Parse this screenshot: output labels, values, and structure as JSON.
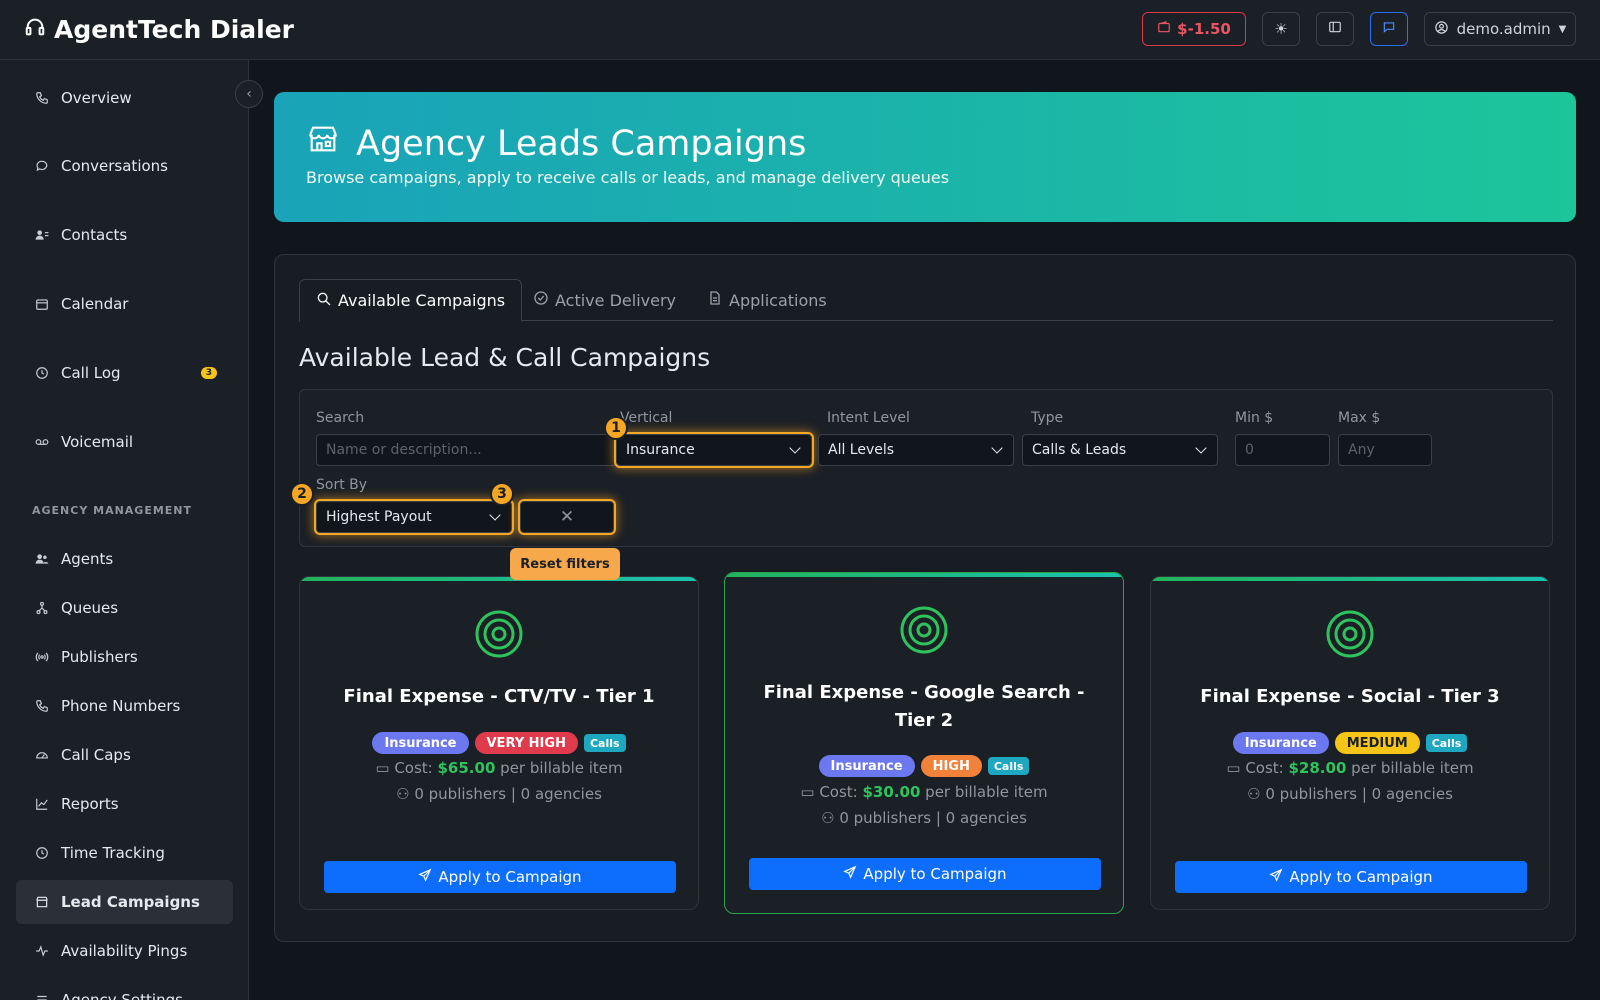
{
  "app": {
    "title": "AgentTech Dialer",
    "balance": "$-1.50",
    "user": "demo.admin"
  },
  "sidebar": {
    "items": [
      {
        "label": "Overview"
      },
      {
        "label": "Conversations"
      },
      {
        "label": "Contacts"
      },
      {
        "label": "Calendar"
      },
      {
        "label": "Call Log",
        "badge": "3"
      },
      {
        "label": "Voicemail"
      }
    ],
    "section_label": "AGENCY MANAGEMENT",
    "agency_items": [
      {
        "label": "Agents"
      },
      {
        "label": "Queues"
      },
      {
        "label": "Publishers"
      },
      {
        "label": "Phone Numbers"
      },
      {
        "label": "Call Caps"
      },
      {
        "label": "Reports"
      },
      {
        "label": "Time Tracking"
      },
      {
        "label": "Lead Campaigns",
        "active": true
      },
      {
        "label": "Availability Pings"
      },
      {
        "label": "Agency Settings"
      }
    ]
  },
  "hero": {
    "title": "Agency Leads Campaigns",
    "subtitle": "Browse campaigns, apply to receive calls or leads, and manage delivery queues"
  },
  "tabs": [
    {
      "label": "Available Campaigns",
      "active": true
    },
    {
      "label": "Active Delivery"
    },
    {
      "label": "Applications"
    }
  ],
  "section_title": "Available Lead & Call Campaigns",
  "filters": {
    "search": {
      "label": "Search",
      "placeholder": "Name or description..."
    },
    "vertical": {
      "label": "Vertical",
      "value": "Insurance"
    },
    "intent": {
      "label": "Intent Level",
      "value": "All Levels"
    },
    "type": {
      "label": "Type",
      "value": "Calls & Leads"
    },
    "min": {
      "label": "Min $",
      "placeholder": "0"
    },
    "max": {
      "label": "Max $",
      "placeholder": "Any"
    },
    "sort": {
      "label": "Sort By",
      "value": "Highest Payout"
    },
    "reset_tooltip": "Reset filters"
  },
  "markers": [
    "1",
    "2",
    "3"
  ],
  "cards": [
    {
      "title": "Final Expense - CTV/TV - Tier 1",
      "vertical": "Insurance",
      "intent": "VERY HIGH",
      "kind": "Calls",
      "cost_label": "Cost:",
      "cost": "$65.00",
      "cost_suffix": "per billable item",
      "stats": "0 publishers | 0 agencies",
      "button": "Apply to Campaign"
    },
    {
      "title": "Final Expense - Google Search - Tier 2",
      "vertical": "Insurance",
      "intent": "HIGH",
      "kind": "Calls",
      "cost_label": "Cost:",
      "cost": "$30.00",
      "cost_suffix": "per billable item",
      "stats": "0 publishers | 0 agencies",
      "button": "Apply to Campaign"
    },
    {
      "title": "Final Expense - Social - Tier 3",
      "vertical": "Insurance",
      "intent": "MEDIUM",
      "kind": "Calls",
      "cost_label": "Cost:",
      "cost": "$28.00",
      "cost_suffix": "per billable item",
      "stats": "0 publishers | 0 agencies",
      "button": "Apply to Campaign"
    }
  ],
  "colors": {
    "accent": "#0d6efd",
    "highlight": "#f5a623",
    "success": "#2ec35c",
    "danger": "#e03b4c"
  }
}
